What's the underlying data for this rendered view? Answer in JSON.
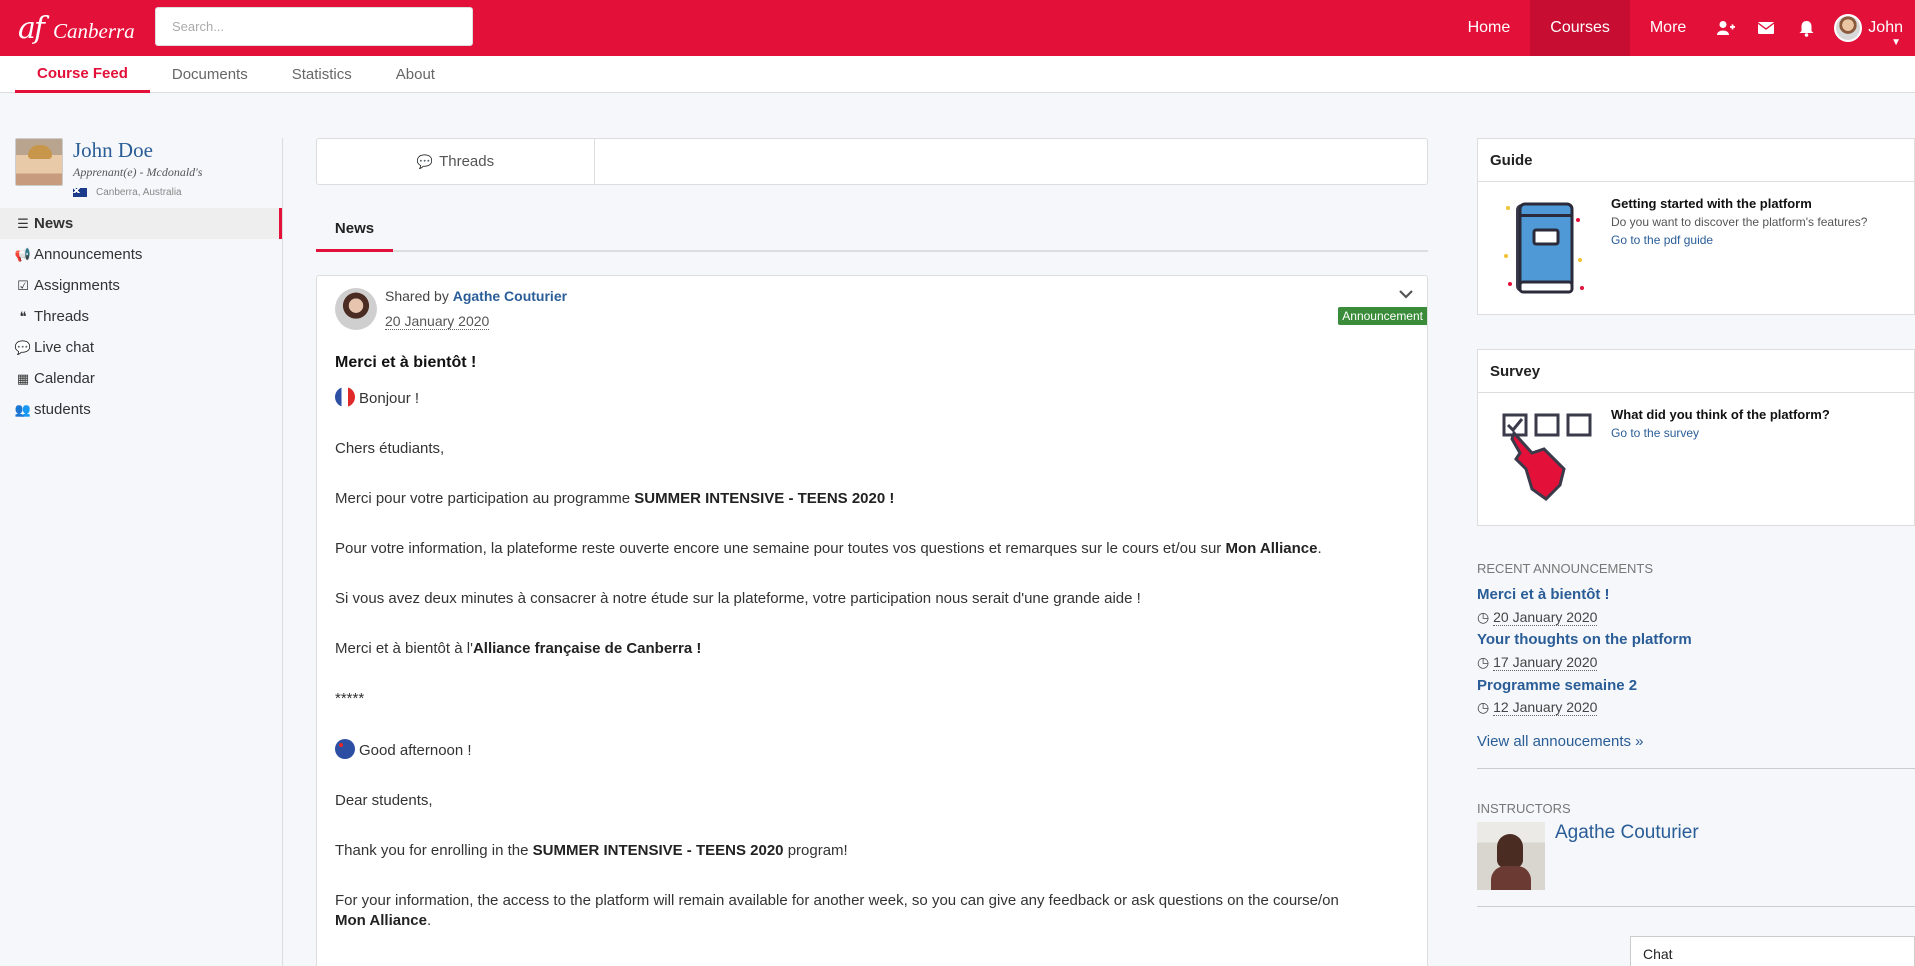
{
  "brand": {
    "logo_mark": "af",
    "city": "Canberra",
    "accent": "#e31039"
  },
  "search": {
    "placeholder": "Search..."
  },
  "topnav": {
    "items": [
      {
        "label": "Home"
      },
      {
        "label": "Courses",
        "active": true
      },
      {
        "label": "More"
      }
    ],
    "icons": [
      "add-user-icon",
      "envelope-icon",
      "bell-icon"
    ],
    "user": {
      "name": "John"
    }
  },
  "subnav": {
    "tabs": [
      {
        "label": "Course Feed",
        "active": true
      },
      {
        "label": "Documents"
      },
      {
        "label": "Statistics"
      },
      {
        "label": "About"
      }
    ]
  },
  "profile": {
    "name": "John Doe",
    "role": "Apprenant(e) - Mcdonald's",
    "location": "Canberra, Australia"
  },
  "sidebar": {
    "items": [
      {
        "label": "News",
        "icon": "list-icon",
        "active": true
      },
      {
        "label": "Announcements",
        "icon": "bullhorn-icon"
      },
      {
        "label": "Assignments",
        "icon": "checkbox-icon"
      },
      {
        "label": "Threads",
        "icon": "quote-icon"
      },
      {
        "label": "Live chat",
        "icon": "comment-icon"
      },
      {
        "label": "Calendar",
        "icon": "calendar-icon"
      },
      {
        "label": "students",
        "icon": "users-icon"
      }
    ]
  },
  "threads_tab": {
    "label": "Threads"
  },
  "news_tab": {
    "label": "News"
  },
  "post": {
    "shared_by": "Shared by",
    "author": "Agathe Couturier",
    "date": "20 January 2020",
    "badge": "Announcement",
    "title": "Merci et à bientôt !",
    "fr_greeting": "Bonjour !",
    "fr_p1": "Chers étudiants,",
    "fr_p2_a": "Merci pour votre participation au programme ",
    "fr_p2_b": "SUMMER INTENSIVE - TEENS 2020 !",
    "fr_p3_a": "Pour votre information, la plateforme reste ouverte encore une semaine pour toutes vos questions et remarques sur le cours et/ou sur ",
    "fr_p3_b": "Mon Alliance",
    "fr_p3_c": ".",
    "fr_p4": "Si vous avez deux minutes à consacrer à notre étude sur la plateforme, votre participation nous serait d'une grande aide !",
    "fr_p5_a": "Merci et à bientôt à l'",
    "fr_p5_b": "Alliance française de Canberra !",
    "separator": "*****",
    "en_greeting": "Good afternoon !",
    "en_p1": "Dear students,",
    "en_p2_a": "Thank you for enrolling in the ",
    "en_p2_b": "SUMMER INTENSIVE - TEENS 2020",
    "en_p2_c": " program!",
    "en_p3_a": "For your information, the access to the platform will remain available for another week, so you can give any feedback or ask questions on the course/on ",
    "en_p3_b": "Mon Alliance",
    "en_p3_c": "."
  },
  "guide": {
    "title": "Guide",
    "heading": "Getting started with the platform",
    "text": "Do you want to discover the platform's features?",
    "link": "Go to the pdf guide"
  },
  "survey": {
    "title": "Survey",
    "heading": "What did you think of the platform?",
    "link": "Go to the survey"
  },
  "recent": {
    "label": "RECENT ANNOUNCEMENTS",
    "items": [
      {
        "title": "Merci et à bientôt !",
        "date": "20 January 2020"
      },
      {
        "title": "Your thoughts on the platform",
        "date": "17 January 2020"
      },
      {
        "title": "Programme semaine 2",
        "date": "12 January 2020"
      }
    ],
    "view_all": "View all annoucements »"
  },
  "instructors": {
    "label": "INSTRUCTORS",
    "name": "Agathe Couturier"
  },
  "chat": {
    "label": "Chat"
  }
}
